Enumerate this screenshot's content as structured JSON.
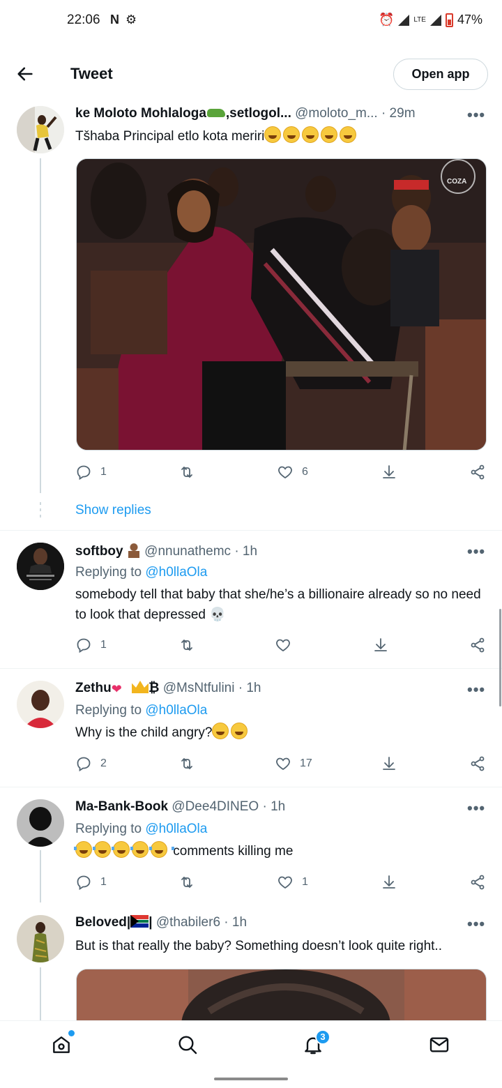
{
  "status_bar": {
    "time": "22:06",
    "left_icons": "N ⚙",
    "network": "LTE",
    "battery": "47%"
  },
  "header": {
    "title": "Tweet",
    "open_app": "Open app"
  },
  "tweets": [
    {
      "name": "ke Moloto Mohlaloga",
      "name_suffix": ",setlogol...",
      "handle": "@moloto_m...",
      "time": "· 29m",
      "text": "Tšhaba Principal etlo kota meriri",
      "replies": "1",
      "likes": "6",
      "image_watermark": "COZA"
    },
    {
      "name": "softboy",
      "handle": "@nnunathemc",
      "time": "· 1h",
      "replying_prefix": "Replying to",
      "replying_to": "@h0llaOla",
      "text": "somebody tell that baby that she/he’s a billionaire already so no need to look that depressed 💀",
      "replies": "1"
    },
    {
      "name": "Zethu",
      "name_suffix": "₿",
      "handle": "@MsNtfulini",
      "time": "· 1h",
      "replying_prefix": "Replying to",
      "replying_to": "@h0llaOla",
      "text": "Why is the child angry?",
      "replies": "2",
      "likes": "17"
    },
    {
      "name": "Ma-Bank-Book",
      "handle": "@Dee4DINEO",
      "time": "· 1h",
      "replying_prefix": "Replying to",
      "replying_to": "@h0llaOla",
      "text": "comments killing me",
      "replies": "1",
      "likes": "1"
    },
    {
      "name": "Beloved|",
      "name_suffix": "|",
      "handle": "@thabiler6",
      "time": "· 1h",
      "text": "But is that really the baby? Something doesn’t look quite right.."
    }
  ],
  "show_replies": "Show replies",
  "more": "•••",
  "nav": {
    "notifications_badge": "3"
  },
  "icons": [
    "back-arrow-icon",
    "reply-icon",
    "retweet-icon",
    "like-icon",
    "download-icon",
    "share-icon",
    "home-icon",
    "search-icon",
    "bell-icon",
    "mail-icon"
  ]
}
